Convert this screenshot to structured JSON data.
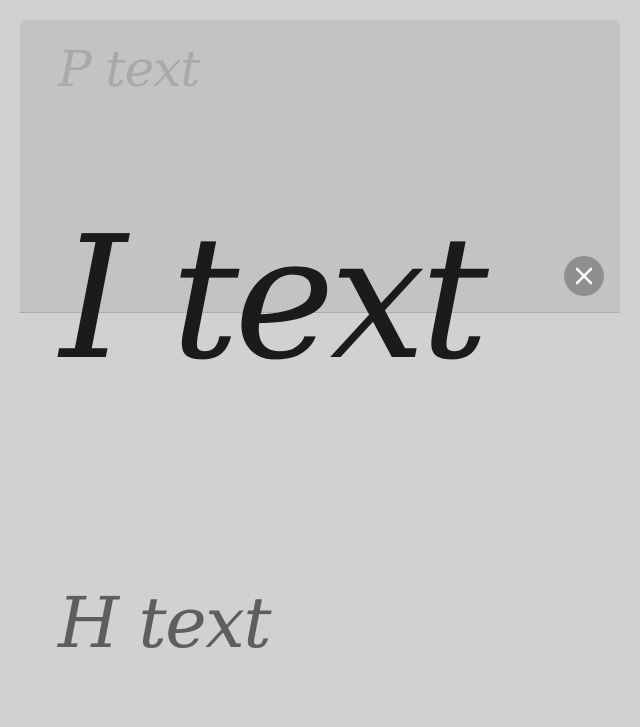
{
  "items": {
    "p": {
      "label": "P text"
    },
    "i": {
      "label": "I text"
    },
    "h": {
      "label": "H text"
    }
  },
  "close": {
    "icon": "close-icon"
  },
  "colors": {
    "background": "#d1d1d1",
    "panel": "#c3c3c3",
    "p_text": "#a9a9a9",
    "i_text": "#1b1b1b",
    "h_text": "#5e5e5e",
    "close_button": "#8f8f8f"
  }
}
